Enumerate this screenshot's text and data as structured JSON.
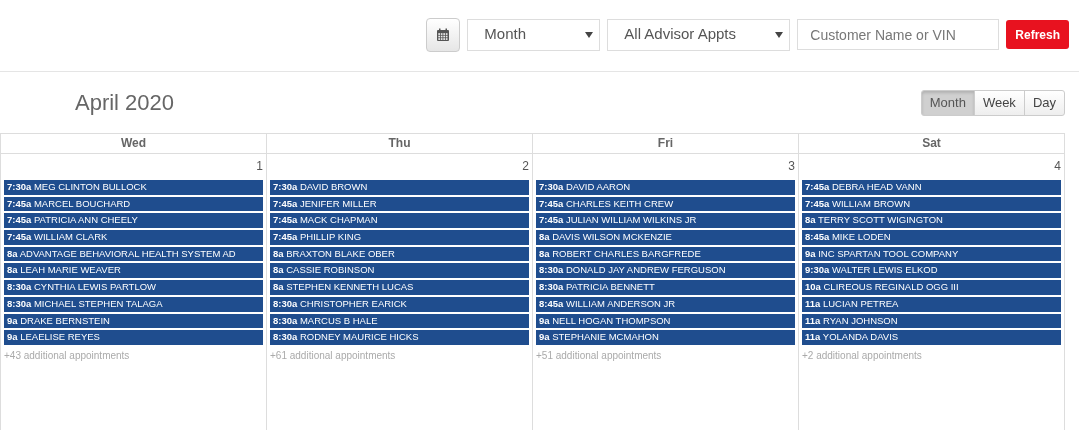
{
  "toolbar": {
    "view_select": "Month",
    "filter_select": "All Advisor Appts",
    "search": {
      "placeholder": "Customer Name or VIN"
    },
    "refresh": "Refresh"
  },
  "title": "April 2020",
  "views": [
    {
      "label": "Month",
      "selected": true
    },
    {
      "label": "Week",
      "selected": false
    },
    {
      "label": "Day",
      "selected": false
    }
  ],
  "days": [
    {
      "weekday": "Wed",
      "date": "1",
      "more": "+43 additional appointments",
      "events": [
        {
          "time": "7:30a",
          "name": "MEG CLINTON BULLOCK"
        },
        {
          "time": "7:45a",
          "name": "MARCEL BOUCHARD"
        },
        {
          "time": "7:45a",
          "name": "PATRICIA ANN CHEELY"
        },
        {
          "time": "7:45a",
          "name": "WILLIAM CLARK"
        },
        {
          "time": "8a",
          "name": "ADVANTAGE BEHAVIORAL HEALTH SYSTEM AD"
        },
        {
          "time": "8a",
          "name": "LEAH MARIE WEAVER"
        },
        {
          "time": "8:30a",
          "name": "CYNTHIA LEWIS PARTLOW"
        },
        {
          "time": "8:30a",
          "name": "MICHAEL STEPHEN TALAGA"
        },
        {
          "time": "9a",
          "name": "DRAKE BERNSTEIN"
        },
        {
          "time": "9a",
          "name": "LEAELISE REYES"
        }
      ]
    },
    {
      "weekday": "Thu",
      "date": "2",
      "more": "+61 additional appointments",
      "events": [
        {
          "time": "7:30a",
          "name": "DAVID BROWN"
        },
        {
          "time": "7:45a",
          "name": "JENIFER MILLER"
        },
        {
          "time": "7:45a",
          "name": "MACK CHAPMAN"
        },
        {
          "time": "7:45a",
          "name": "PHILLIP KING"
        },
        {
          "time": "8a",
          "name": "BRAXTON BLAKE OBER"
        },
        {
          "time": "8a",
          "name": "CASSIE ROBINSON"
        },
        {
          "time": "8a",
          "name": "STEPHEN KENNETH LUCAS"
        },
        {
          "time": "8:30a",
          "name": "CHRISTOPHER EARICK"
        },
        {
          "time": "8:30a",
          "name": "MARCUS B HALE"
        },
        {
          "time": "8:30a",
          "name": "RODNEY MAURICE HICKS"
        }
      ]
    },
    {
      "weekday": "Fri",
      "date": "3",
      "more": "+51 additional appointments",
      "events": [
        {
          "time": "7:30a",
          "name": "DAVID AARON"
        },
        {
          "time": "7:45a",
          "name": "CHARLES KEITH CREW"
        },
        {
          "time": "7:45a",
          "name": "JULIAN WILLIAM WILKINS JR"
        },
        {
          "time": "8a",
          "name": "DAVIS WILSON MCKENZIE"
        },
        {
          "time": "8a",
          "name": "ROBERT CHARLES BARGFREDE"
        },
        {
          "time": "8:30a",
          "name": "DONALD JAY ANDREW FERGUSON"
        },
        {
          "time": "8:30a",
          "name": "PATRICIA BENNETT"
        },
        {
          "time": "8:45a",
          "name": "WILLIAM ANDERSON JR"
        },
        {
          "time": "9a",
          "name": "NELL HOGAN THOMPSON"
        },
        {
          "time": "9a",
          "name": "STEPHANIE MCMAHON"
        }
      ]
    },
    {
      "weekday": "Sat",
      "date": "4",
      "more": "+2 additional appointments",
      "events": [
        {
          "time": "7:45a",
          "name": "DEBRA HEAD VANN"
        },
        {
          "time": "7:45a",
          "name": "WILLIAM BROWN"
        },
        {
          "time": "8a",
          "name": "TERRY SCOTT WIGINGTON"
        },
        {
          "time": "8:45a",
          "name": "MIKE LODEN"
        },
        {
          "time": "9a",
          "name": "INC SPARTAN TOOL COMPANY"
        },
        {
          "time": "9:30a",
          "name": "WALTER LEWIS ELKOD"
        },
        {
          "time": "10a",
          "name": "CLIREOUS REGINALD OGG III"
        },
        {
          "time": "11a",
          "name": "LUCIAN PETREA"
        },
        {
          "time": "11a",
          "name": "RYAN JOHNSON"
        },
        {
          "time": "11a",
          "name": "YOLANDA DAVIS"
        }
      ]
    }
  ]
}
